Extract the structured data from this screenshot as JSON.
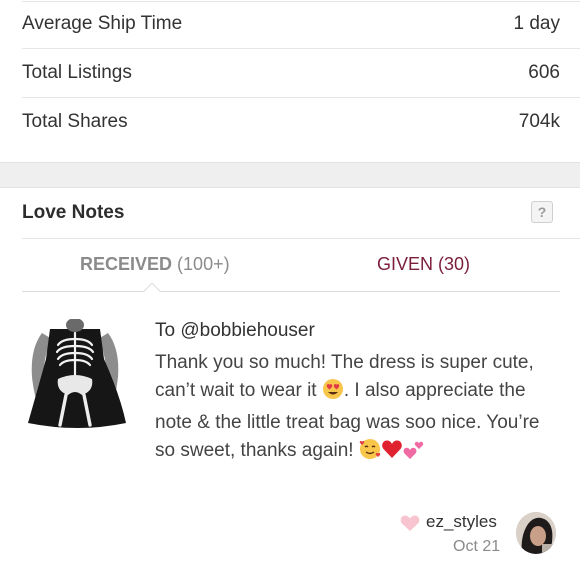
{
  "stats": [
    {
      "label": "Average Ship Time",
      "value": "1 day"
    },
    {
      "label": "Total Listings",
      "value": "606"
    },
    {
      "label": "Total Shares",
      "value": "704k"
    }
  ],
  "love_notes": {
    "title": "Love Notes",
    "help_symbol": "?",
    "tabs": {
      "received_label": "RECEIVED",
      "received_count": "(100+)",
      "given_label": "GIVEN (30)"
    },
    "note": {
      "to": "To @bobbiehouser",
      "body_1": "Thank you so much! The dress is super cute, can’t wait to wear it ",
      "body_2": ". I also appreciate the note & the little treat bag was soo nice. You’re so sweet, thanks again! ",
      "emoji_1": "heart-eyes-emoji",
      "emoji_end": [
        "smiling-hearts-emoji",
        "red-heart-emoji",
        "two-hearts-emoji"
      ],
      "author": "ez_styles",
      "date": "Oct 21"
    }
  },
  "colors": {
    "given_tab": "#7a1e3a",
    "received_tab": "#8b8b8b",
    "heart": "#f7c4cf"
  }
}
